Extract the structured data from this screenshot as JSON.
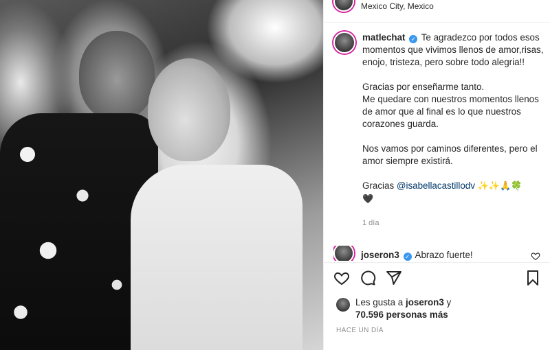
{
  "post": {
    "location": "Mexico City, Mexico",
    "author": "matlechat",
    "caption": {
      "p1": "Te agradezco por todos esos momentos que vivimos llenos de amor,risas, enojo, tristeza, pero sobre todo alegria!!",
      "p2_line1": "Gracias por enseñarme tanto.",
      "p2_line2": "Me quedare con nuestros momentos llenos de amor que al final es lo que nuestros corazones guarda.",
      "p3": "Nos vamos por caminos diferentes, pero el amor siempre existirá.",
      "p4_prefix": "Gracias",
      "p4_mention": "@isabellacastillodv",
      "p4_emoji": "✨✨🙏🍀",
      "p5_emoji": "🖤"
    },
    "time_ago": "1 día",
    "comment": {
      "user": "joseron3",
      "text": "Abrazo fuerte!"
    },
    "likes": {
      "prefix": "Les gusta a",
      "user": "joseron3",
      "joiner": "y",
      "count_text": "70.596 personas más"
    },
    "posted_label": "HACE UN DÍA"
  },
  "icons": [
    "verified-badge-icon",
    "heart-icon",
    "comment-icon",
    "share-icon",
    "bookmark-icon"
  ],
  "colors": {
    "verified": "#3897f0",
    "mention": "#00376b",
    "muted": "#8e8e8e",
    "text": "#262626"
  }
}
